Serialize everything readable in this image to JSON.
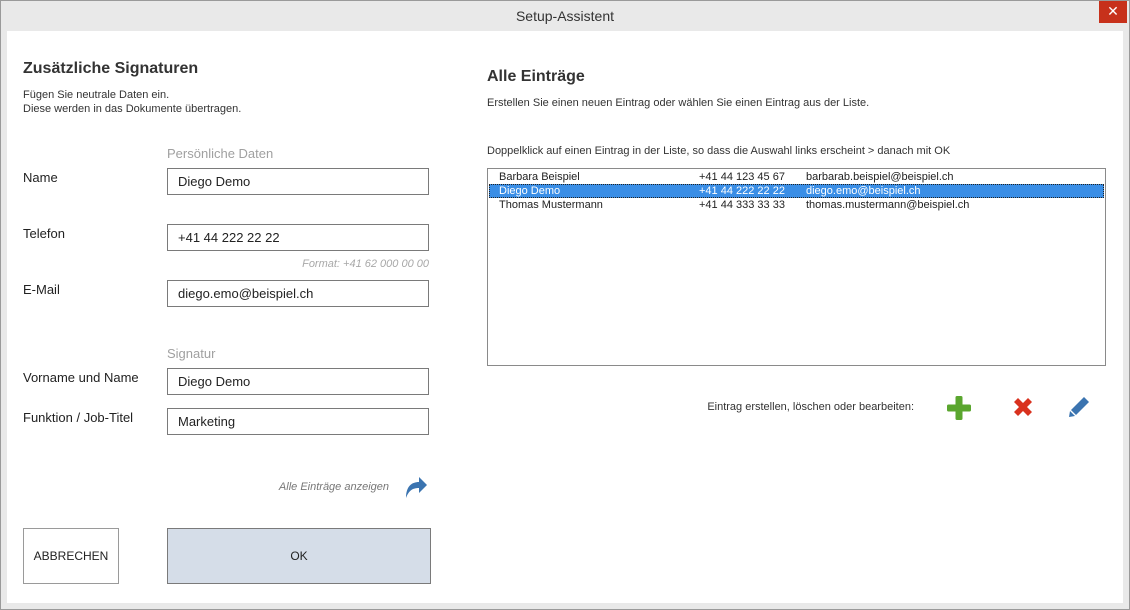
{
  "window": {
    "title": "Setup-Assistent",
    "close_label": "✕"
  },
  "left": {
    "heading": "Zusätzliche Signaturen",
    "intro_line1": "Fügen Sie neutrale Daten ein.",
    "intro_line2": "Diese werden in das Dokumente übertragen.",
    "section_personal": "Persönliche Daten",
    "name_label": "Name",
    "name_value": "Diego Demo",
    "phone_label": "Telefon",
    "phone_value": "+41 44 222 22 22",
    "phone_hint": "Format: +41 62 000 00 00",
    "email_label": "E-Mail",
    "email_value": "diego.emo@beispiel.ch",
    "section_signature": "Signatur",
    "fullname_label": "Vorname und Name",
    "fullname_value": "Diego Demo",
    "function_label": "Funktion / Job-Titel",
    "function_value": "Marketing",
    "show_all_label": "Alle Einträge anzeigen",
    "cancel_label": "ABBRECHEN",
    "ok_label": "OK"
  },
  "right": {
    "heading": "Alle Einträge",
    "intro": "Erstellen Sie einen neuen Eintrag oder wählen Sie einen Eintrag aus der Liste.",
    "instruction": "Doppelklick auf einen Eintrag in der Liste, so dass die Auswahl links erscheint > danach mit OK",
    "entries": [
      {
        "name": "Barbara Beispiel",
        "phone": "+41 44 123 45 67",
        "email": "barbarab.beispiel@beispiel.ch"
      },
      {
        "name": "Diego Demo",
        "phone": "+41 44 222 22 22",
        "email": "diego.emo@beispiel.ch"
      },
      {
        "name": "Thomas Mustermann",
        "phone": "+41 44 333 33 33",
        "email": "thomas.mustermann@beispiel.ch"
      }
    ],
    "actions_label": "Eintrag erstellen, löschen oder bearbeiten:"
  },
  "colors": {
    "accent_selection": "#3a8ee6",
    "add_green": "#5aa62e",
    "delete_red": "#d9311e",
    "edit_blue": "#3b74b0",
    "ok_button_bg": "#d5dde8"
  }
}
